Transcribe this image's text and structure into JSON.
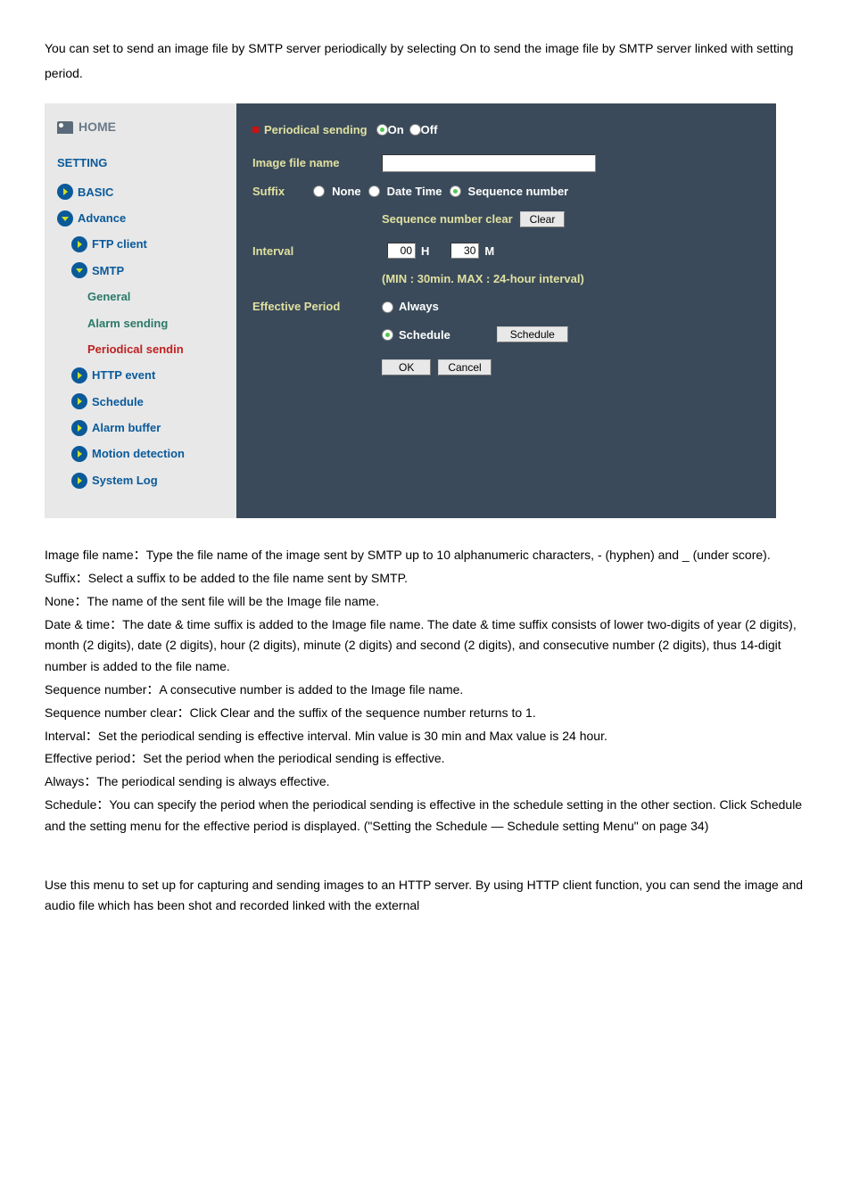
{
  "intro": "You can set to send an image file by SMTP server periodically by selecting On to send the image file by SMTP server linked with setting period.",
  "sidebar": {
    "home": "HOME",
    "setting": "SETTING",
    "basic": "BASIC",
    "advance": "Advance",
    "ftp": "FTP client",
    "smtp": "SMTP",
    "general": "General",
    "alarm_sending": "Alarm sending",
    "periodical_sending": "Periodical sendin",
    "http_event": "HTTP event",
    "schedule": "Schedule",
    "alarm_buffer": "Alarm buffer",
    "motion_detection": "Motion detection",
    "system_log": "System Log"
  },
  "panel": {
    "title": "Periodical sending",
    "on": "On",
    "off": "Off",
    "image_file_name": "Image file name",
    "suffix": "Suffix",
    "none": "None",
    "date_time": "Date Time",
    "sequence_number": "Sequence number",
    "seq_clear": "Sequence number clear",
    "clear_btn": "Clear",
    "interval": "Interval",
    "h_val": "00",
    "h": "H",
    "m_val": "30",
    "m": "M",
    "hint": "(MIN : 30min. MAX : 24-hour interval)",
    "effective_period": "Effective Period",
    "always": "Always",
    "schedule": "Schedule",
    "schedule_btn": "Schedule",
    "ok": "OK",
    "cancel": "Cancel"
  },
  "body": {
    "p1": "Image file name：Type the file name of the image sent by SMTP up to 10 alphanumeric characters, - (hyphen) and _ (under score).",
    "p2": "Suffix：Select a suffix to be added to the file name sent by SMTP.",
    "p3": "None：The name of the sent file will be the Image file name.",
    "p4": "Date & time：The date & time suffix is added to the Image file name. The date & time suffix consists of lower two-digits of year (2 digits), month (2 digits), date (2 digits), hour (2 digits), minute (2 digits) and second (2 digits), and consecutive number (2 digits), thus 14-digit number is added to the file name.",
    "p5": "Sequence number：A consecutive number is added to the Image file name.",
    "p6": "Sequence number clear：Click Clear and the suffix of the sequence number returns to 1.",
    "p7": "Interval：Set the periodical sending is effective interval. Min value is 30 min and Max value is 24 hour.",
    "p8": "Effective period：Set the period when the periodical sending is effective.",
    "p9": "Always：The periodical sending is always effective.",
    "p10": "Schedule：You can specify the period when the periodical sending is effective in the schedule setting in the other section. Click Schedule and the setting menu for the effective period is displayed. (\"Setting the Schedule — Schedule setting Menu\" on page 34)",
    "p11": "Use this menu to set up for capturing and sending images to an HTTP server. By using HTTP client function, you can send the image and audio file which has been shot and recorded linked with the external"
  }
}
